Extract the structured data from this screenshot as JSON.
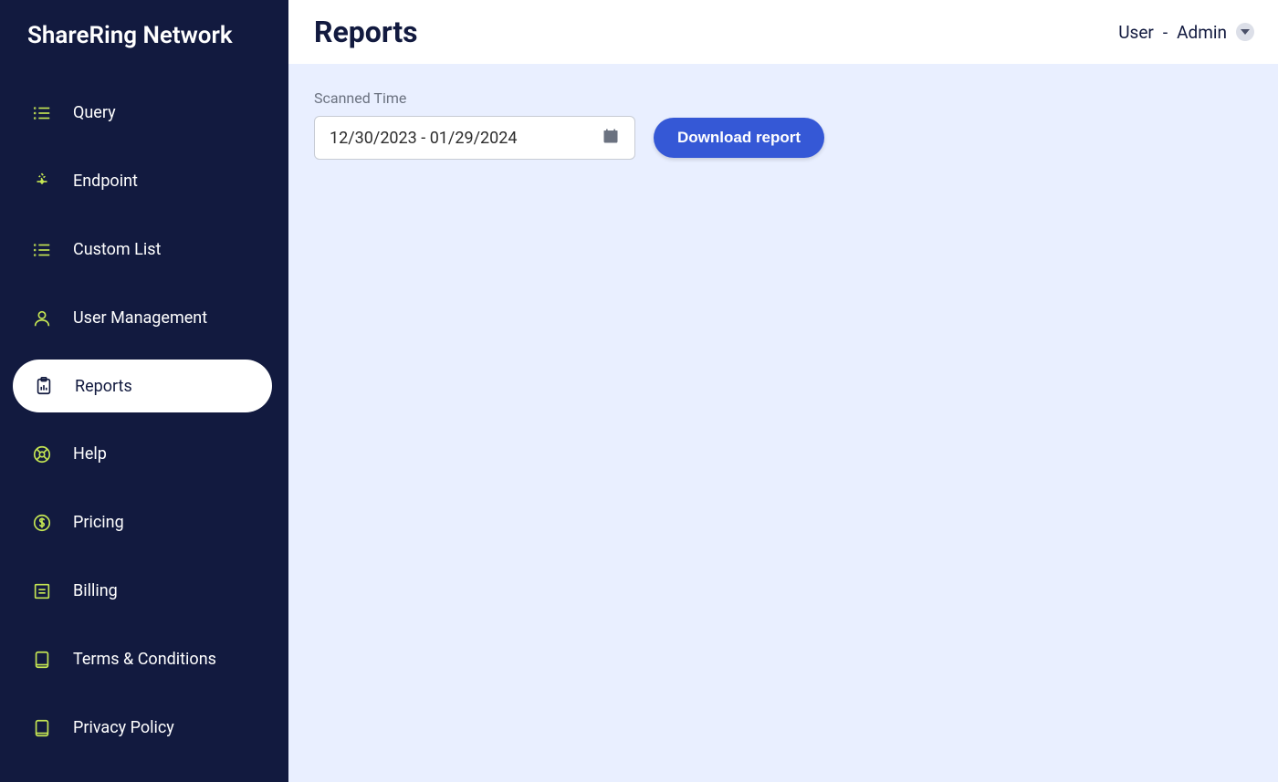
{
  "brand": "ShareRing Network",
  "sidebar": {
    "items": [
      {
        "label": "Query",
        "icon": "list-icon",
        "active": false
      },
      {
        "label": "Endpoint",
        "icon": "endpoint-icon",
        "active": false
      },
      {
        "label": "Custom List",
        "icon": "list-icon",
        "active": false
      },
      {
        "label": "User Management",
        "icon": "user-icon",
        "active": false
      },
      {
        "label": "Reports",
        "icon": "clipboard-icon",
        "active": true
      },
      {
        "label": "Help",
        "icon": "help-icon",
        "active": false
      },
      {
        "label": "Pricing",
        "icon": "dollar-icon",
        "active": false
      },
      {
        "label": "Billing",
        "icon": "billing-icon",
        "active": false
      },
      {
        "label": "Terms & Conditions",
        "icon": "document-icon",
        "active": false
      },
      {
        "label": "Privacy Policy",
        "icon": "document-icon",
        "active": false
      }
    ]
  },
  "header": {
    "title": "Reports",
    "user_label": "User",
    "separator": "-",
    "role": "Admin"
  },
  "content": {
    "scanned_time_label": "Scanned Time",
    "date_range": "12/30/2023 - 01/29/2024",
    "download_label": "Download report"
  }
}
